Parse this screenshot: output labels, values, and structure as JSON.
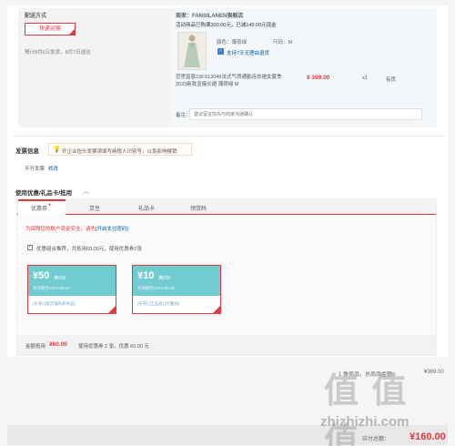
{
  "delivery": {
    "heading": "配送方式",
    "option": "快递运输",
    "estimate": "预计8月6日发货，8月7日送达"
  },
  "shop": {
    "merchant": "商家：FANSILANEN旗舰店",
    "promo": "活动商品已购满300.00元，已减149.00元现金",
    "color_label": "颜色：薄荷绿",
    "size_label": "尺码：M",
    "service": "支持7天无理由退货",
    "product_title": "范思蓝恩23FS12049法式气质通勤连衣裙女夏季2023新款显瘦长裙 薄荷绿 M",
    "price": "¥ 369.00",
    "qty": "x1",
    "stock": "有货",
    "note_label": "备注：",
    "note_placeholder": "建议留言前先与商家沟通确认"
  },
  "invoice": {
    "heading": "发票信息",
    "notice": "开企业抬头发票须填写纳税人识别号，以免影响报销",
    "status": "不开发票",
    "edit": "修改"
  },
  "coupons": {
    "heading": "使用优惠/礼品卡/抵用",
    "tabs": [
      "优惠券",
      "京豆",
      "礼品卡",
      "领货码"
    ],
    "warning": "为保障您的账户资金安全，请先",
    "warning_link": "[开启支付密码]",
    "combo_text": "优惠组合推荐，共抵用60.00元，使用优惠券2张",
    "items": [
      {
        "amount": "¥50",
        "cond": "满300",
        "date": "有效期至2023-08-07",
        "tags": "[东券] [限店铺商家商品]"
      },
      {
        "amount": "¥10",
        "cond": "满200",
        "date": "有效期至2023-08-05",
        "tags": "[东券] [全品类] [可叠加]"
      }
    ],
    "summary_label": "金额抵用",
    "summary_amount": "¥60.00",
    "summary_detail": "使用优惠券 2 张，优惠 60.00 元"
  },
  "totals": {
    "goods_label": "1 件商品，总商品金额：",
    "goods_value": "¥369.00",
    "pay_label": "应付总额：",
    "pay_value": "¥160.00"
  },
  "watermark": {
    "big": "值 值 值",
    "site": "zhizhizhi.com"
  },
  "colors": {
    "accent": "#e4393c",
    "coupon_teal": "#71ccd2",
    "link": "#005ea7"
  }
}
